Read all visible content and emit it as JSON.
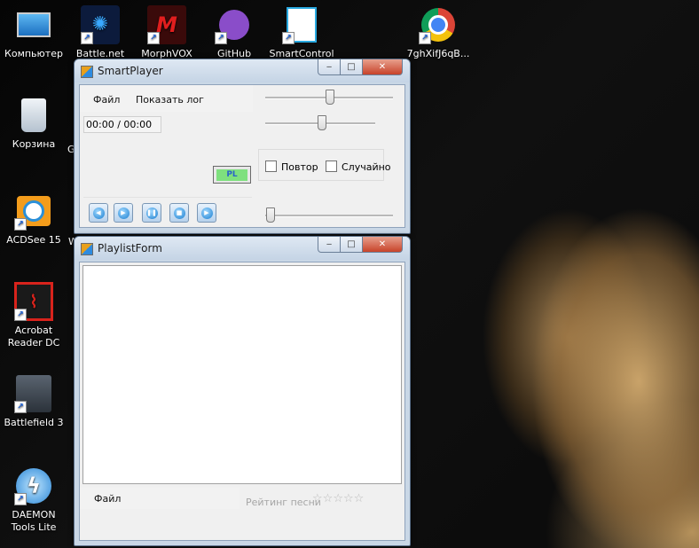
{
  "desktop": {
    "icons": [
      {
        "label": "Компьютер",
        "icon": "computer-icon"
      },
      {
        "label": "Battle.net",
        "icon": "battlenet-icon"
      },
      {
        "label": "MorphVOX",
        "icon": "morphvox-icon"
      },
      {
        "label": "GitHub",
        "icon": "github-icon"
      },
      {
        "label": "SmartControl",
        "icon": "smartcontrol-icon"
      },
      {
        "label": "7ghXifJ6qB...",
        "icon": "chrome-icon"
      },
      {
        "label": "Корзина",
        "icon": "recycle-bin-icon"
      },
      {
        "label": "ACDSee 15",
        "icon": "acdsee-icon"
      },
      {
        "label": "Acrobat Reader DC",
        "icon": "acrobat-icon"
      },
      {
        "label": "Battlefield 3",
        "icon": "battlefield-icon"
      },
      {
        "label": "DAEMON Tools Lite",
        "icon": "daemon-tools-icon"
      }
    ],
    "partial_labels": [
      "G",
      "W"
    ]
  },
  "smartplayer": {
    "title": "SmartPlayer",
    "menu": [
      "Файл",
      "Показать лог"
    ],
    "time": "00:00 / 00:00",
    "pl_button": "PL",
    "repeat_label": "Повтор",
    "shuffle_label": "Случайно",
    "controls": [
      "prev-icon",
      "play-icon",
      "pause-icon",
      "stop-icon",
      "next-icon"
    ],
    "colors": {
      "pl_button": "#7ee07e"
    }
  },
  "playlist": {
    "title": "PlaylistForm",
    "menu_file": "Файл",
    "rating_label": "Рейтинг песни",
    "stars": [
      "☆",
      "☆",
      "☆",
      "☆",
      "☆"
    ]
  },
  "window_controls": {
    "minimize": "‒",
    "maximize": "□",
    "close": "✕"
  }
}
